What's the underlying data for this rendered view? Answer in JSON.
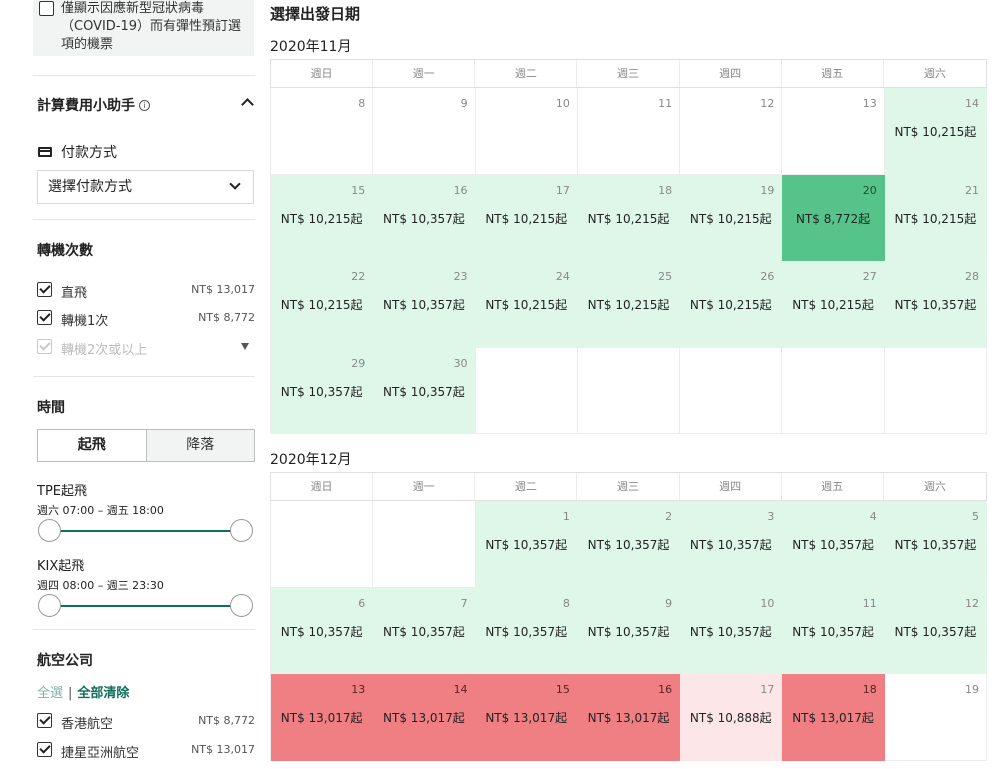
{
  "sidebar": {
    "covid_text": "僅顯示因應新型冠狀病毒（COVID-19）而有彈性預訂選項的機票",
    "calc_title": "計算費用小助手",
    "payment_label": "付款方式",
    "payment_select": "選擇付款方式",
    "stops_title": "轉機次數",
    "stops": [
      {
        "label": "直飛",
        "price": "NT$ 13,017",
        "checked": true,
        "disabled": false
      },
      {
        "label": "轉機1次",
        "price": "NT$ 8,772",
        "checked": true,
        "disabled": false
      },
      {
        "label": "轉機2次或以上",
        "price": "",
        "checked": true,
        "disabled": true
      }
    ],
    "time_title": "時間",
    "tab_depart": "起飛",
    "tab_arrive": "降落",
    "tpe_title": "TPE起飛",
    "tpe_range": "週六 07:00 – 週五 18:00",
    "kix_title": "KIX起飛",
    "kix_range": "週四 08:00 – 週三 23:30",
    "airline_title": "航空公司",
    "select_all": "全選",
    "clear_all": "全部清除",
    "airlines": [
      {
        "label": "香港航空",
        "price": "NT$ 8,772",
        "checked": true
      },
      {
        "label": "捷星亞洲航空",
        "price": "NT$ 13,017",
        "checked": true
      }
    ]
  },
  "calendar": {
    "title": "選擇出發日期",
    "weekdays": [
      "週日",
      "週一",
      "週二",
      "週三",
      "週四",
      "週五",
      "週六"
    ],
    "months": [
      {
        "title": "2020年11月",
        "cells": [
          {
            "d": "8",
            "p": "",
            "c": "empty"
          },
          {
            "d": "9",
            "p": "",
            "c": "empty"
          },
          {
            "d": "10",
            "p": "",
            "c": "empty"
          },
          {
            "d": "11",
            "p": "",
            "c": "empty"
          },
          {
            "d": "12",
            "p": "",
            "c": "empty"
          },
          {
            "d": "13",
            "p": "",
            "c": "empty"
          },
          {
            "d": "14",
            "p": "NT$ 10,215起",
            "c": "green"
          },
          {
            "d": "15",
            "p": "NT$ 10,215起",
            "c": "green"
          },
          {
            "d": "16",
            "p": "NT$ 10,357起",
            "c": "green"
          },
          {
            "d": "17",
            "p": "NT$ 10,215起",
            "c": "green"
          },
          {
            "d": "18",
            "p": "NT$ 10,215起",
            "c": "green"
          },
          {
            "d": "19",
            "p": "NT$ 10,215起",
            "c": "green"
          },
          {
            "d": "20",
            "p": "NT$ 8,772起",
            "c": "dark"
          },
          {
            "d": "21",
            "p": "NT$ 10,215起",
            "c": "green"
          },
          {
            "d": "22",
            "p": "NT$ 10,215起",
            "c": "green"
          },
          {
            "d": "23",
            "p": "NT$ 10,357起",
            "c": "green"
          },
          {
            "d": "24",
            "p": "NT$ 10,215起",
            "c": "green"
          },
          {
            "d": "25",
            "p": "NT$ 10,215起",
            "c": "green"
          },
          {
            "d": "26",
            "p": "NT$ 10,215起",
            "c": "green"
          },
          {
            "d": "27",
            "p": "NT$ 10,215起",
            "c": "green"
          },
          {
            "d": "28",
            "p": "NT$ 10,357起",
            "c": "green"
          },
          {
            "d": "29",
            "p": "NT$ 10,357起",
            "c": "green"
          },
          {
            "d": "30",
            "p": "NT$ 10,357起",
            "c": "green"
          },
          {
            "d": "",
            "p": "",
            "c": "empty"
          },
          {
            "d": "",
            "p": "",
            "c": "empty"
          },
          {
            "d": "",
            "p": "",
            "c": "empty"
          },
          {
            "d": "",
            "p": "",
            "c": "empty"
          },
          {
            "d": "",
            "p": "",
            "c": "empty"
          }
        ]
      },
      {
        "title": "2020年12月",
        "cells": [
          {
            "d": "",
            "p": "",
            "c": "empty"
          },
          {
            "d": "",
            "p": "",
            "c": "empty"
          },
          {
            "d": "1",
            "p": "NT$ 10,357起",
            "c": "green"
          },
          {
            "d": "2",
            "p": "NT$ 10,357起",
            "c": "green"
          },
          {
            "d": "3",
            "p": "NT$ 10,357起",
            "c": "green"
          },
          {
            "d": "4",
            "p": "NT$ 10,357起",
            "c": "green"
          },
          {
            "d": "5",
            "p": "NT$ 10,357起",
            "c": "green"
          },
          {
            "d": "6",
            "p": "NT$ 10,357起",
            "c": "green"
          },
          {
            "d": "7",
            "p": "NT$ 10,357起",
            "c": "green"
          },
          {
            "d": "8",
            "p": "NT$ 10,357起",
            "c": "green"
          },
          {
            "d": "9",
            "p": "NT$ 10,357起",
            "c": "green"
          },
          {
            "d": "10",
            "p": "NT$ 10,357起",
            "c": "green"
          },
          {
            "d": "11",
            "p": "NT$ 10,357起",
            "c": "green"
          },
          {
            "d": "12",
            "p": "NT$ 10,357起",
            "c": "green"
          },
          {
            "d": "13",
            "p": "NT$ 13,017起",
            "c": "red"
          },
          {
            "d": "14",
            "p": "NT$ 13,017起",
            "c": "red"
          },
          {
            "d": "15",
            "p": "NT$ 13,017起",
            "c": "red"
          },
          {
            "d": "16",
            "p": "NT$ 13,017起",
            "c": "red"
          },
          {
            "d": "17",
            "p": "NT$ 10,888起",
            "c": "pink"
          },
          {
            "d": "18",
            "p": "NT$ 13,017起",
            "c": "red"
          },
          {
            "d": "19",
            "p": "",
            "c": "empty"
          }
        ]
      }
    ]
  }
}
